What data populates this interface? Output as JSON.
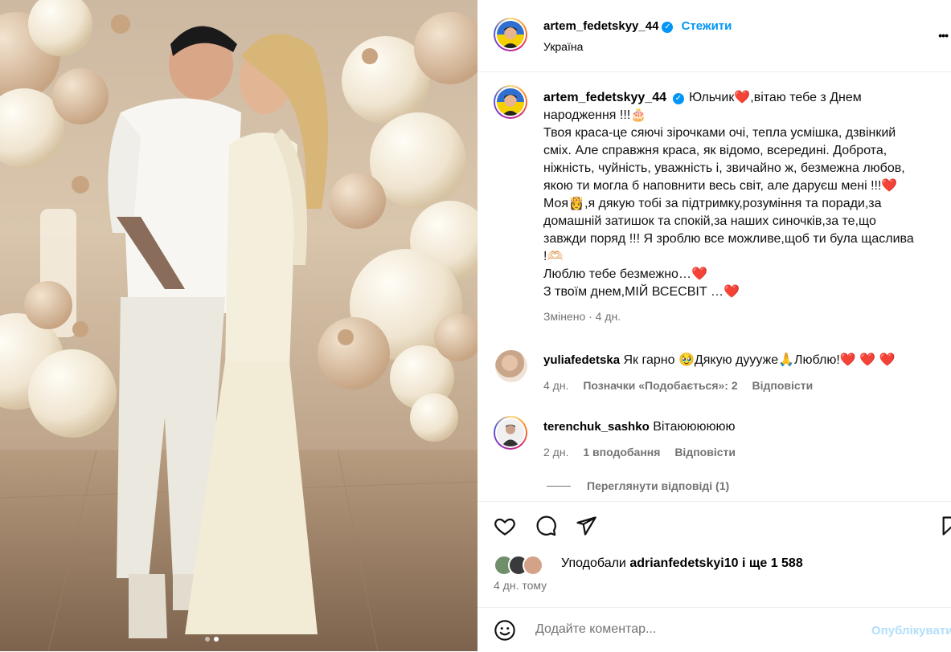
{
  "post": {
    "author": "artem_fedetskyy_44",
    "location": "Україна",
    "follow_label": "Стежити",
    "verified_mark": "✓",
    "more_icon": "•••",
    "carousel_dots": 2,
    "caption": {
      "lines": [
        "Юльчик❤️,вітаю тебе з Днем",
        "народження !!!🎂",
        "Твоя краса-це сяючі зірочками очі, тепла усмішка, дзвінкий",
        "сміх. Але справжня краса, як відомо, всередині. Доброта,",
        "ніжність, чуйність, уважність і, звичайно ж, безмежна любов,",
        "якою ти могла б наповнити весь світ, але даруєш мені !!!❤️",
        "Моя👸,я дякую тобі за підтримку,розуміння та поради,за",
        "домашній затишок та спокій,за наших синочків,за те,що",
        "завжди поряд !!! Я зроблю все можливе,щоб ти була щаслива",
        "!🫶🏻",
        "Люблю тебе безмежно…❤️",
        "З твоїм днем,МІЙ ВСЕСВІТ …❤️"
      ],
      "meta": "Змінено · 4 дн."
    }
  },
  "comments": [
    {
      "user": "yuliafedetska",
      "text": "Як гарно 🥹Дякую дуууже🙏Люблю!❤️ ❤️ ❤️",
      "time": "4 дн.",
      "likes": "Позначки «Подобається»: 2",
      "reply": "Відповісти"
    },
    {
      "user": "terenchuk_sashko",
      "text": "Вітаюююююю",
      "time": "2 дн.",
      "likes": "1 вподобання",
      "reply": "Відповісти",
      "view_replies": "Переглянути відповіді (1)"
    }
  ],
  "actions": {
    "like_icon": "heart-icon",
    "comment_icon": "comment-icon",
    "share_icon": "share-icon",
    "save_icon": "bookmark-icon",
    "likes_prefix": "Уподобали",
    "likes_user": "adrianfedetskyi10",
    "likes_suffix": "і ще 1 588",
    "time": "4 дн. тому"
  },
  "composer": {
    "emoji_icon": "smiley-icon",
    "placeholder": "Додайте коментар...",
    "publish_label": "Опублікувати"
  },
  "colors": {
    "accent": "#0095f6",
    "muted": "#737373",
    "heart": "#e0142a",
    "publish_disabled": "#b2dffc"
  }
}
